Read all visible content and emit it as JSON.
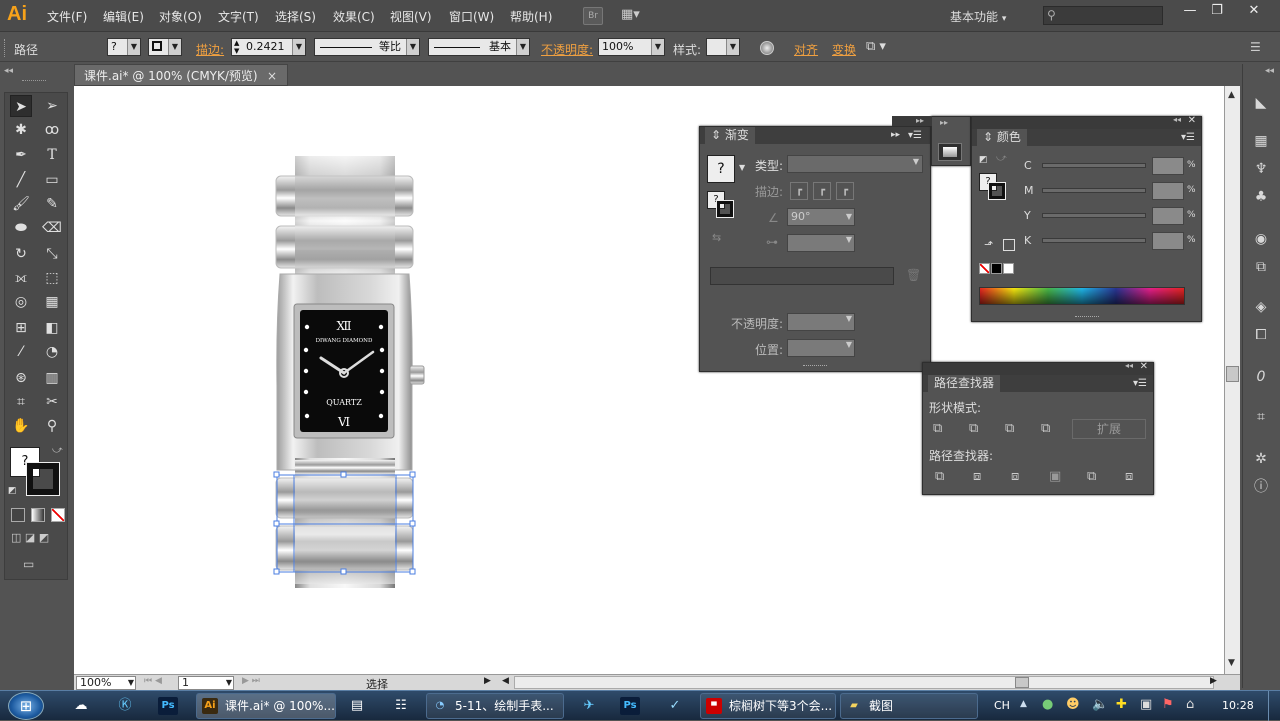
{
  "app": {
    "logo": "Ai",
    "bridge": "Br",
    "arrange": "▦▾"
  },
  "menu": [
    "文件(F)",
    "编辑(E)",
    "对象(O)",
    "文字(T)",
    "选择(S)",
    "效果(C)",
    "视图(V)",
    "窗口(W)",
    "帮助(H)"
  ],
  "workspace": {
    "label": "基本功能",
    "arrow": "▾"
  },
  "search": {
    "placeholder": ""
  },
  "window_controls": {
    "minimize": "—",
    "restore": "❐",
    "close": "✕"
  },
  "controlbar": {
    "object_type": "路径",
    "fill_value": "?",
    "stroke_label": "描边:",
    "stroke_weight": "0.2421",
    "profile_label": "等比",
    "brush_label": "基本",
    "opacity_label": "不透明度:",
    "opacity_value": "100%",
    "style_label": "样式:",
    "align_label": "对齐",
    "transform_label": "变换"
  },
  "document": {
    "tab_title": "课件.ai* @ 100% (CMYK/预览)",
    "close": "×"
  },
  "watch": {
    "brand": "DIWANG DIAMOND",
    "movement": "QUARTZ",
    "numeral_top": "Ⅻ",
    "numeral_bottom": "Ⅵ"
  },
  "gradient_panel": {
    "title": "渐变",
    "fill_icon": "?",
    "type_label": "类型:",
    "stroke_label": "描边:",
    "angle_value": "90°",
    "opacity_label": "不透明度:",
    "position_label": "位置:"
  },
  "color_panel": {
    "title": "颜色",
    "fill_icon": "?",
    "channels": [
      "C",
      "M",
      "Y",
      "K"
    ],
    "percent": "%"
  },
  "pathfinder_panel": {
    "title": "路径查找器",
    "shape_modes_label": "形状模式:",
    "expand_label": "扩展",
    "pathfinders_label": "路径查找器:"
  },
  "statusbar": {
    "zoom": "100%",
    "page": "1",
    "tool": "选择"
  },
  "taskbar": {
    "ai_window": "课件.ai* @ 100%...",
    "ai_icon": "Ai",
    "browser_window": "5-11、绘制手表...",
    "ps_icon": "Ps",
    "folder_window1": "棕榈树下等3个会...",
    "folder_window2": "截图",
    "ime": "CH",
    "clock": "10:28"
  },
  "colors": {
    "accent": "#f0a040",
    "selection": "#4a7de0",
    "dial": "#0a0a0a"
  }
}
